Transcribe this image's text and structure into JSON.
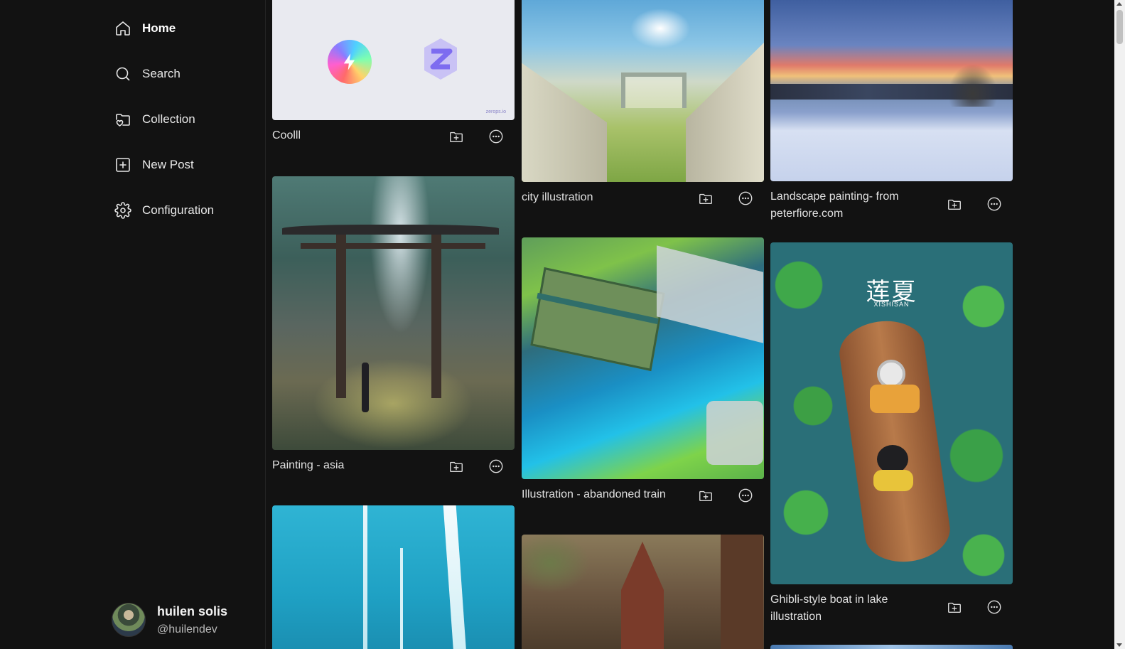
{
  "sidebar": {
    "nav": [
      {
        "label": "Home",
        "icon": "home-icon",
        "active": true
      },
      {
        "label": "Search",
        "icon": "search-icon"
      },
      {
        "label": "Collection",
        "icon": "folder-heart-icon"
      },
      {
        "label": "New Post",
        "icon": "plus-square-icon"
      },
      {
        "label": "Configuration",
        "icon": "gear-icon"
      }
    ],
    "profile": {
      "name": "huilen solis",
      "handle": "@huilendev"
    }
  },
  "posts": [
    {
      "caption": "Coolll"
    },
    {
      "caption": "Painting - asia"
    },
    {
      "caption": ""
    },
    {
      "caption": "city illustration"
    },
    {
      "caption": "Illustration - abandoned train"
    },
    {
      "caption": ""
    },
    {
      "caption": "Landscape painting- from peterfiore.com"
    },
    {
      "caption": "Ghibli-style boat in lake illustration"
    }
  ],
  "post1_overlay": {
    "title_cn": "莲夏",
    "subtitle": "XISHISAN"
  },
  "post0_watermark": "zerops.io",
  "colors": {
    "background": "#121212",
    "text": "#e6e6e6"
  }
}
